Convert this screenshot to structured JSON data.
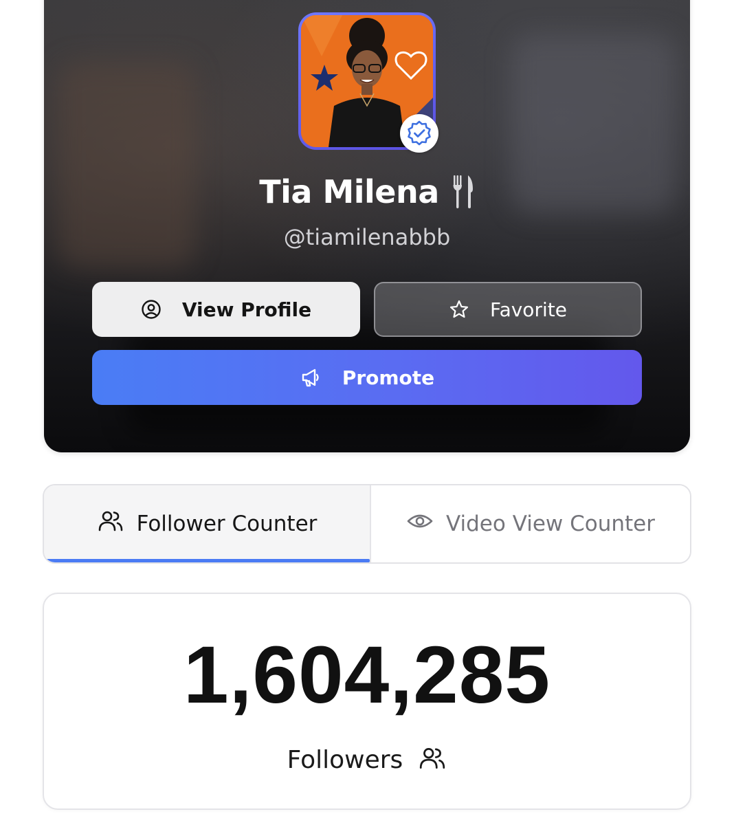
{
  "profile": {
    "name": "Tia Milena",
    "name_emoji_icon": "fork-and-knife-icon",
    "handle": "@tiamilenabbb",
    "verified": true
  },
  "actions": {
    "view_profile_label": "View Profile",
    "favorite_label": "Favorite",
    "promote_label": "Promote"
  },
  "tabs": [
    {
      "label": "Follower Counter",
      "icon": "users-icon",
      "active": true
    },
    {
      "label": "Video View Counter",
      "icon": "eye-icon",
      "active": false
    }
  ],
  "counter": {
    "value": "1,604,285",
    "label": "Followers",
    "icon": "users-icon"
  },
  "colors": {
    "accent_blue": "#4a7bf4",
    "promote_gradient_end": "#6358ec",
    "card_dark": "#17171a",
    "avatar_background": "#ea6f1d"
  }
}
